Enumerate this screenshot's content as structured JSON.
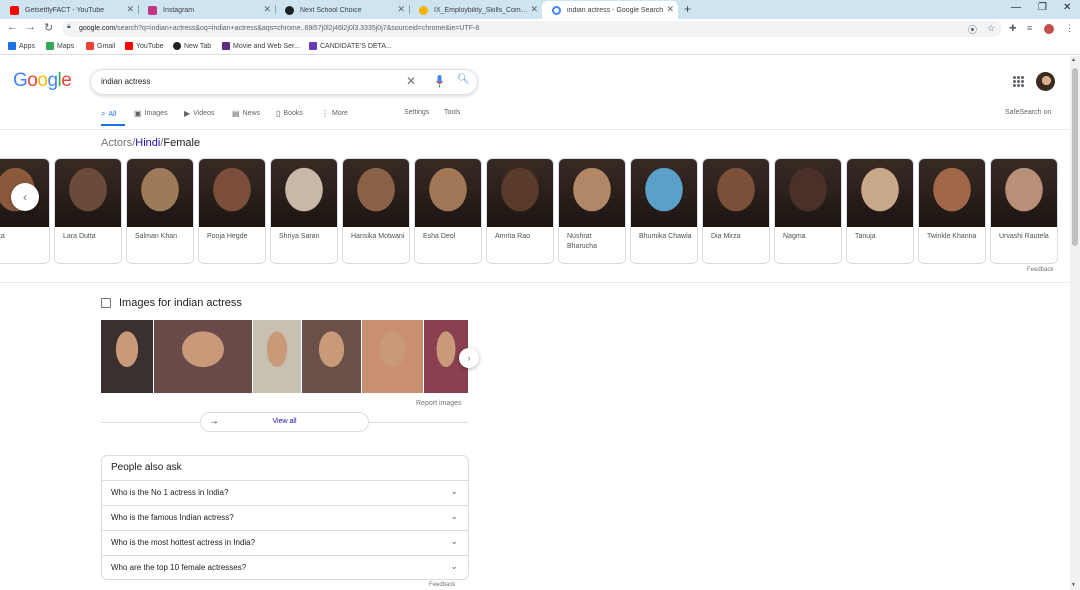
{
  "browser": {
    "tabs": [
      {
        "title": "GetsetflyFACT - YouTube",
        "color": "#ff0000"
      },
      {
        "title": "Instagram",
        "color": "#c13584"
      },
      {
        "title": "Next School Choice",
        "color": "#202124"
      },
      {
        "title": "IX_Employbility_Skills_Combined_",
        "color": "#f4b400"
      },
      {
        "title": "indian actress - Google Search",
        "color": "#4285f4"
      }
    ],
    "url_host": "google.com",
    "url_rest": "/search?q=indian+actress&oq=indian+actress&aqs=chrome..69i57j0l2j46l2j0l3.3335j0j7&sourceid=chrome&ie=UTF-8",
    "bookmarks": [
      {
        "label": "Apps",
        "color": "#1a73e8"
      },
      {
        "label": "Maps",
        "color": "#34a853"
      },
      {
        "label": "Gmail",
        "color": "#ea4335"
      },
      {
        "label": "YouTube",
        "color": "#ff0000"
      },
      {
        "label": "New Tab",
        "color": "#202124"
      },
      {
        "label": "Movie and Web Ser...",
        "color": "#5f2c82"
      },
      {
        "label": "CANDIDATE'S DETA...",
        "color": "#673ab7"
      }
    ]
  },
  "search": {
    "logo": "Google",
    "query": "indian actress",
    "tabs": [
      "All",
      "Images",
      "Videos",
      "News",
      "Books",
      "More"
    ],
    "settings": "Settings",
    "tools": "Tools",
    "safesearch": "SafeSearch on"
  },
  "breadcrumb": {
    "part1": "Actors",
    "sep": "/",
    "part2": "Hindi",
    "part3": "Female"
  },
  "actresses": [
    {
      "name": "...ika",
      "color": "#8b5a3c"
    },
    {
      "name": "Lara Dutta",
      "color": "#6b4a3a"
    },
    {
      "name": "Salman Khan",
      "color": "#9c7a5a"
    },
    {
      "name": "Pooja Hegde",
      "color": "#7a4e3a"
    },
    {
      "name": "Shriya Saran",
      "color": "#c9b8a8"
    },
    {
      "name": "Hansika Motwani",
      "color": "#8a6248"
    },
    {
      "name": "Esha Deol",
      "color": "#a07858"
    },
    {
      "name": "Amrita Rao",
      "color": "#5a3a2a"
    },
    {
      "name": "Nushrat Bharucha",
      "color": "#b08868"
    },
    {
      "name": "Bhumika Chawla",
      "color": "#5aa0c8"
    },
    {
      "name": "Dia Mirza",
      "color": "#7a5038"
    },
    {
      "name": "Nagma",
      "color": "#4a3028"
    },
    {
      "name": "Tanuja",
      "color": "#c8a888"
    },
    {
      "name": "Twinkle Khanna",
      "color": "#a06848"
    },
    {
      "name": "Urvashi Rautela",
      "color": "#b89078"
    }
  ],
  "feedback": "Feedback",
  "images": {
    "title": "Images for indian actress",
    "thumb_colors": [
      "#3a3030",
      "#6a4a48",
      "#c8c0b0",
      "#6a5048",
      "#c89070",
      "#8a4050"
    ],
    "report": "Report images",
    "view_all": "View all"
  },
  "paa": {
    "title": "People also ask",
    "questions": [
      "Who is the No 1 actress in India?",
      "Who is the famous Indian actress?",
      "Who is the most hottest actress in India?",
      "Who are the top 10 female actresses?"
    ]
  },
  "feedback2": "Feedback"
}
